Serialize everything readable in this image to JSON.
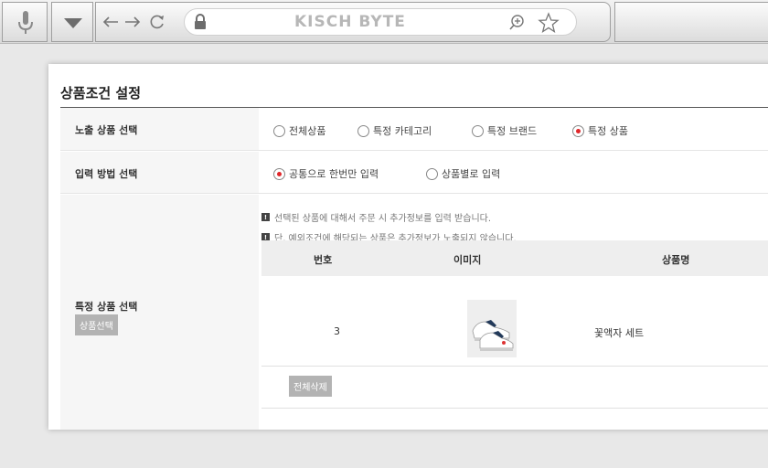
{
  "browser": {
    "url_text": "KISCH BYTE",
    "icons": [
      "microphone-icon",
      "dropdown-icon",
      "back-icon",
      "forward-icon",
      "reload-icon",
      "lock-icon",
      "zoom-icon",
      "star-icon"
    ]
  },
  "section": {
    "title": "상품조건 설정"
  },
  "rows": {
    "exposure": {
      "label": "노출 상품 선택",
      "options": [
        "전체상품",
        "특정 카테고리",
        "특정 브랜드",
        "특정 상품"
      ],
      "selected": "특정 상품"
    },
    "input_method": {
      "label": "입력 방법 선택",
      "options": [
        "공통으로 한번만 입력",
        "상품별로 입력"
      ],
      "selected": "공통으로 한번만 입력"
    },
    "product_select": {
      "label": "특정 상품 선택",
      "button": "상품선택",
      "notes": [
        "선택된 상품에 대해서 주문 시 추가정보를 입력 받습니다.",
        "단, 예외조건에 해당되는 상품은 추가정보가 노출되지 않습니다."
      ],
      "table": {
        "headers": [
          "번호",
          "이미지",
          "상품명"
        ],
        "rows": [
          {
            "number": "3",
            "name": "꽃액자 세트"
          }
        ]
      },
      "delete_all": "전체삭제"
    }
  },
  "colors": {
    "accent": "#e0262a",
    "button_gray": "#b3b3b3"
  }
}
